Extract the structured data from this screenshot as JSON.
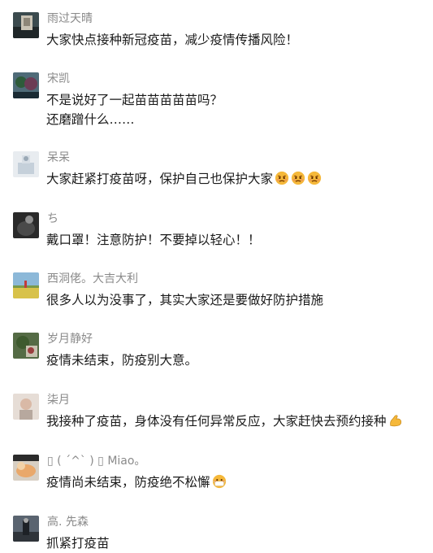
{
  "comments": [
    {
      "name": "雨过天晴",
      "text": "大家快点接种新冠疫苗，减少疫情传播风险！",
      "emojis": []
    },
    {
      "name": "宋凯",
      "text": "不是说好了一起苗苗苗苗苗吗？\n还磨蹭什么……",
      "emojis": []
    },
    {
      "name": "呆呆",
      "text": "大家赶紧打疫苗呀，保护自己也保护大家",
      "emojis": [
        "angry-face-icon",
        "angry-face-icon",
        "angry-face-icon"
      ]
    },
    {
      "name": "ち",
      "text": "戴口罩！注意防护！不要掉以轻心！！",
      "emojis": []
    },
    {
      "name": "西洞佬。大吉大利",
      "text": "很多人以为没事了，其实大家还是要做好防护措施",
      "emojis": []
    },
    {
      "name": "岁月静好",
      "text": "疫情未结束，防疫别大意。",
      "emojis": []
    },
    {
      "name": "柒月",
      "text": "我接种了疫苗，身体没有任何异常反应，大家赶快去预约接种",
      "emojis": [
        "flexed-biceps-icon"
      ]
    },
    {
      "name": "▯ ( ´^` ) ▯ Miao。",
      "text": "疫情尚未结束，防疫绝不松懈",
      "emojis": [
        "mask-face-icon"
      ]
    },
    {
      "name": "高. 先森",
      "text": "抓紧打疫苗",
      "emojis": []
    }
  ]
}
